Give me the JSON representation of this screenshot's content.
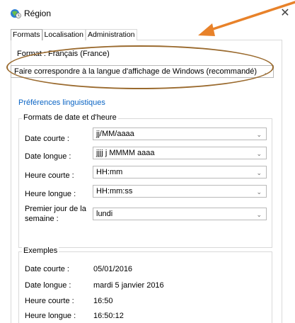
{
  "window": {
    "title": "Région",
    "close_glyph": "✕"
  },
  "tabs": [
    {
      "label": "Formats",
      "active": true
    },
    {
      "label": "Localisation",
      "active": false
    },
    {
      "label": "Administration",
      "active": false
    }
  ],
  "format": {
    "label": "Format : Français (France)",
    "selected": "Faire correspondre à la langue d'affichage de Windows (recommandé)"
  },
  "language_link": "Préférences linguistiques",
  "date_time_formats": {
    "title": "Formats de date et d'heure",
    "rows": [
      {
        "label": "Date courte :",
        "value": "jj/MM/aaaa"
      },
      {
        "label": "Date longue :",
        "value": "jjjj j MMMM aaaa"
      },
      {
        "label": "Heure courte :",
        "value": "HH:mm"
      },
      {
        "label": "Heure longue :",
        "value": "HH:mm:ss"
      },
      {
        "label": "Premier jour de la semaine :",
        "value": "lundi"
      }
    ]
  },
  "examples": {
    "title": "Exemples",
    "rows": [
      {
        "label": "Date courte :",
        "value": "05/01/2016"
      },
      {
        "label": "Date longue :",
        "value": "mardi 5 janvier 2016"
      },
      {
        "label": "Heure courte :",
        "value": "16:50"
      },
      {
        "label": "Heure longue :",
        "value": "16:50:12"
      }
    ]
  },
  "colors": {
    "accent_link": "#0a64c4",
    "annotation_arrow": "#e8822a",
    "annotation_ellipse": "#9a6a2e"
  },
  "icons": {
    "window": "globe-clock-icon",
    "dropdown": "chevron-down-icon"
  }
}
